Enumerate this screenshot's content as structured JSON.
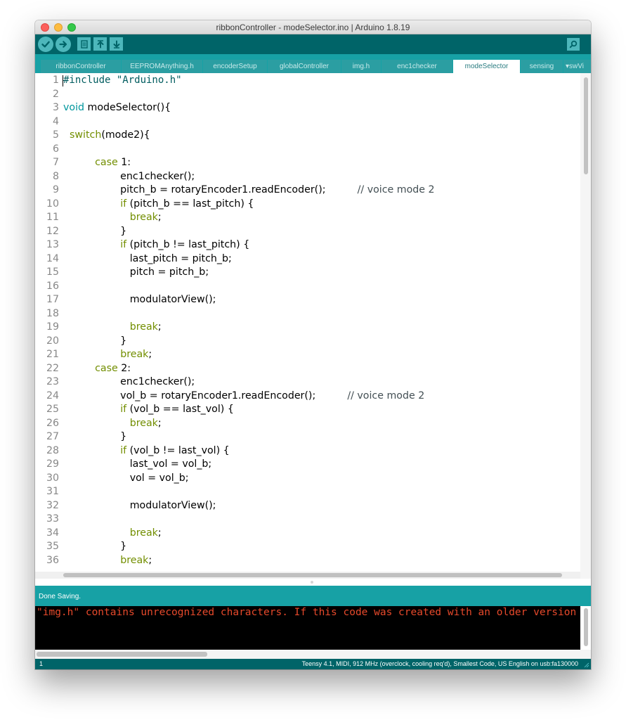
{
  "window": {
    "title": "ribbonController - modeSelector.ino | Arduino 1.8.19"
  },
  "toolbar": {
    "buttons": [
      {
        "name": "verify",
        "icon": "checkmark-icon"
      },
      {
        "name": "upload",
        "icon": "right-arrow-icon"
      },
      {
        "name": "new",
        "icon": "new-file-icon"
      },
      {
        "name": "open",
        "icon": "up-arrow-icon"
      },
      {
        "name": "save",
        "icon": "down-arrow-icon"
      },
      {
        "name": "serial_monitor",
        "icon": "magnifier-icon"
      }
    ]
  },
  "tabs": [
    {
      "label": "ribbonController",
      "active": false
    },
    {
      "label": "EEPROMAnything.h",
      "active": false
    },
    {
      "label": "encoderSetup",
      "active": false
    },
    {
      "label": "globalController",
      "active": false
    },
    {
      "label": "img.h",
      "active": false
    },
    {
      "label": "enc1checker",
      "active": false
    },
    {
      "label": "modeSelector",
      "active": true
    },
    {
      "label": "sensing",
      "active": false
    }
  ],
  "tab_menu": {
    "label": "swVi",
    "icon": "triangle-down-icon"
  },
  "editor": {
    "lines": [
      {
        "n": "1",
        "tokens": [
          [
            "string",
            "#include \"Arduino.h\""
          ]
        ]
      },
      {
        "n": "2",
        "tokens": []
      },
      {
        "n": "3",
        "tokens": [
          [
            "type",
            "void"
          ],
          [
            "plain",
            " modeSelector(){"
          ]
        ]
      },
      {
        "n": "4",
        "tokens": []
      },
      {
        "n": "5",
        "tokens": [
          [
            "plain",
            "  "
          ],
          [
            "keyword",
            "switch"
          ],
          [
            "plain",
            "(mode2){"
          ]
        ]
      },
      {
        "n": "6",
        "tokens": []
      },
      {
        "n": "7",
        "tokens": [
          [
            "plain",
            "          "
          ],
          [
            "keyword",
            "case"
          ],
          [
            "plain",
            " 1:"
          ]
        ]
      },
      {
        "n": "8",
        "tokens": [
          [
            "plain",
            "                  enc1checker();"
          ]
        ]
      },
      {
        "n": "9",
        "tokens": [
          [
            "plain",
            "                  pitch_b = rotaryEncoder1.readEncoder();          "
          ],
          [
            "comment",
            "// voice mode 2"
          ]
        ]
      },
      {
        "n": "10",
        "tokens": [
          [
            "plain",
            "                  "
          ],
          [
            "keyword",
            "if"
          ],
          [
            "plain",
            " (pitch_b == last_pitch) {"
          ]
        ]
      },
      {
        "n": "11",
        "tokens": [
          [
            "plain",
            "                     "
          ],
          [
            "keyword",
            "break"
          ],
          [
            "plain",
            ";"
          ]
        ]
      },
      {
        "n": "12",
        "tokens": [
          [
            "plain",
            "                  }"
          ]
        ]
      },
      {
        "n": "13",
        "tokens": [
          [
            "plain",
            "                  "
          ],
          [
            "keyword",
            "if"
          ],
          [
            "plain",
            " (pitch_b != last_pitch) {"
          ]
        ]
      },
      {
        "n": "14",
        "tokens": [
          [
            "plain",
            "                     last_pitch = pitch_b;"
          ]
        ]
      },
      {
        "n": "15",
        "tokens": [
          [
            "plain",
            "                     pitch = pitch_b;"
          ]
        ]
      },
      {
        "n": "16",
        "tokens": []
      },
      {
        "n": "17",
        "tokens": [
          [
            "plain",
            "                     modulatorView();"
          ]
        ]
      },
      {
        "n": "18",
        "tokens": []
      },
      {
        "n": "19",
        "tokens": [
          [
            "plain",
            "                     "
          ],
          [
            "keyword",
            "break"
          ],
          [
            "plain",
            ";"
          ]
        ]
      },
      {
        "n": "20",
        "tokens": [
          [
            "plain",
            "                  }"
          ]
        ]
      },
      {
        "n": "21",
        "tokens": [
          [
            "plain",
            "                  "
          ],
          [
            "keyword",
            "break"
          ],
          [
            "plain",
            ";"
          ]
        ]
      },
      {
        "n": "22",
        "tokens": [
          [
            "plain",
            "          "
          ],
          [
            "keyword",
            "case"
          ],
          [
            "plain",
            " 2:"
          ]
        ]
      },
      {
        "n": "23",
        "tokens": [
          [
            "plain",
            "                  enc1checker();"
          ]
        ]
      },
      {
        "n": "24",
        "tokens": [
          [
            "plain",
            "                  vol_b = rotaryEncoder1.readEncoder();          "
          ],
          [
            "comment",
            "// voice mode 2"
          ]
        ]
      },
      {
        "n": "25",
        "tokens": [
          [
            "plain",
            "                  "
          ],
          [
            "keyword",
            "if"
          ],
          [
            "plain",
            " (vol_b == last_vol) {"
          ]
        ]
      },
      {
        "n": "26",
        "tokens": [
          [
            "plain",
            "                     "
          ],
          [
            "keyword",
            "break"
          ],
          [
            "plain",
            ";"
          ]
        ]
      },
      {
        "n": "27",
        "tokens": [
          [
            "plain",
            "                  }"
          ]
        ]
      },
      {
        "n": "28",
        "tokens": [
          [
            "plain",
            "                  "
          ],
          [
            "keyword",
            "if"
          ],
          [
            "plain",
            " (vol_b != last_vol) {"
          ]
        ]
      },
      {
        "n": "29",
        "tokens": [
          [
            "plain",
            "                     last_vol = vol_b;"
          ]
        ]
      },
      {
        "n": "30",
        "tokens": [
          [
            "plain",
            "                     vol = vol_b;"
          ]
        ]
      },
      {
        "n": "31",
        "tokens": []
      },
      {
        "n": "32",
        "tokens": [
          [
            "plain",
            "                     modulatorView();"
          ]
        ]
      },
      {
        "n": "33",
        "tokens": []
      },
      {
        "n": "34",
        "tokens": [
          [
            "plain",
            "                     "
          ],
          [
            "keyword",
            "break"
          ],
          [
            "plain",
            ";"
          ]
        ]
      },
      {
        "n": "35",
        "tokens": [
          [
            "plain",
            "                  }"
          ]
        ]
      },
      {
        "n": "36",
        "tokens": [
          [
            "plain",
            "                  "
          ],
          [
            "keyword",
            "break"
          ],
          [
            "plain",
            ";"
          ]
        ]
      }
    ]
  },
  "status": {
    "message": "Done Saving."
  },
  "console": {
    "text": "\"img.h\" contains unrecognized characters. If this code was created with an older version"
  },
  "footer": {
    "line_number": "1",
    "board_info": "Teensy 4.1, MIDI, 912 MHz (overclock, cooling req'd), Smallest Code, US English on usb:fa130000"
  },
  "colors": {
    "toolbar": "#006468",
    "tabbar": "#17a1a5",
    "keyword": "#728e00",
    "type": "#00979d",
    "string": "#005c5f",
    "console_text": "#e6492b"
  }
}
